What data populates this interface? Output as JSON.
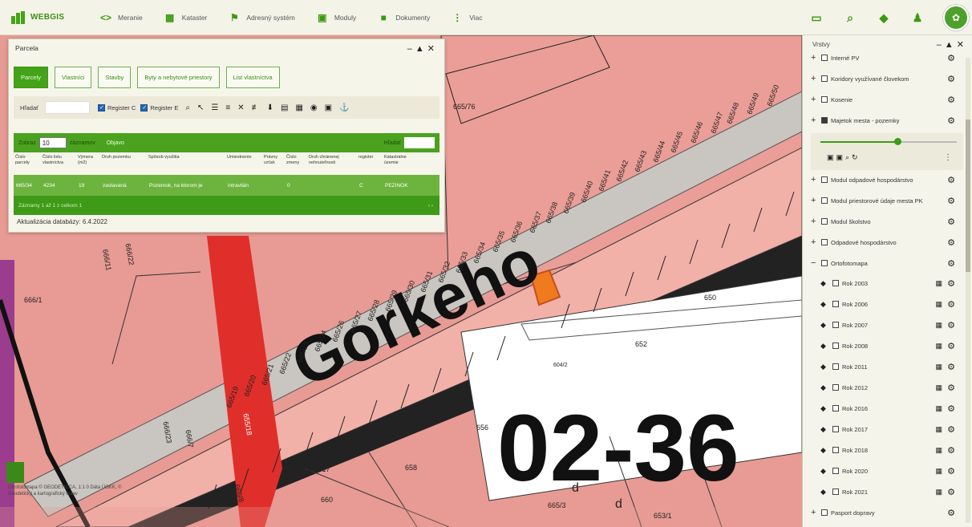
{
  "app": {
    "logo": "WEBGIS"
  },
  "nav": [
    {
      "label": "Meranie",
      "icon": "code-brackets-icon"
    },
    {
      "label": "Kataster",
      "icon": "grid-icon"
    },
    {
      "label": "Adresný systém",
      "icon": "flag-icon"
    },
    {
      "label": "Moduly",
      "icon": "book-icon"
    },
    {
      "label": "Dokumenty",
      "icon": "briefcase-icon"
    },
    {
      "label": "Viac",
      "icon": "more-vertical-icon"
    }
  ],
  "map": {
    "labels": [
      "665/76",
      "665/50",
      "665/49",
      "665/48",
      "665/47",
      "665/46",
      "665/45",
      "665/44",
      "665/43",
      "665/42",
      "665/41",
      "665/40",
      "665/39",
      "665/38",
      "665/37",
      "665/36",
      "665/35",
      "665/34",
      "665/33",
      "665/32",
      "665/31",
      "665/30",
      "665/29",
      "665/28",
      "665/27",
      "665/26",
      "665/24",
      "665/23",
      "665/22",
      "665/21",
      "665/20",
      "665/19",
      "666/22",
      "666/11",
      "666/1",
      "648/2",
      "650",
      "652",
      "604/2",
      "656",
      "658",
      "660",
      "653/1",
      "665/3",
      "665/17",
      "666/7",
      "666/23",
      "655/18",
      "666/8",
      "d",
      "d"
    ],
    "street_text": "Gorkeho",
    "zone_text": "02-36",
    "scale": "Ortofotomapa © GEODETICCA, 1:1 0 Dáta ÚGKK, © Geodetický a kartografický ústav"
  },
  "parcel_panel": {
    "title": "Parcela",
    "tabs": [
      "Parcely",
      "Vlastníci",
      "Stavby",
      "Byty a nebytové priestory",
      "List vlastníctva"
    ],
    "search_label": "Hľadať",
    "register_c": "Register C",
    "register_e": "Register E",
    "show_label": "Zobraz",
    "page_size": "10",
    "page_size_suffix": "záznamov",
    "filter_label": "Objavo",
    "grid_search_label": "Hľadať",
    "columns": [
      "Číslo parcely",
      "Číslo listu vlastníctva",
      "Výmera (m2)",
      "Druh pozemku",
      "Spôsob využitia",
      "Umiestnenie",
      "Právny vzťah",
      "Číslo zmeny",
      "Druh chránenej nehnuteľnosti",
      "register",
      "Katastrálne územie"
    ],
    "row": [
      "665/34",
      "4234",
      "19",
      "zastavaná",
      "Pozemok, na ktorom je",
      "intravilán",
      "",
      "0",
      "",
      "C",
      "PEZINOK"
    ],
    "footer": "Záznamy 1 až 1 z celkom 1",
    "updated": "Aktualizácia databázy: 6.4.2022"
  },
  "layers": {
    "title": "Vrstvy",
    "items": [
      {
        "label": "Interné PV",
        "expand": "+",
        "checked": false
      },
      {
        "label": "Koridory využívané človekom",
        "expand": "+",
        "checked": false
      },
      {
        "label": "Kosenie",
        "expand": "+",
        "checked": false
      },
      {
        "label": "Majetok mesta - pozemky",
        "expand": "+",
        "checked": true
      },
      {
        "label": "Modul odpadové hospodárstvo",
        "expand": "+",
        "checked": false
      },
      {
        "label": "Modul priestorové údaje mesta PK",
        "expand": "+",
        "checked": false
      },
      {
        "label": "Modul školstvo",
        "expand": "+",
        "checked": false
      },
      {
        "label": "Odpadové hospodárstvo",
        "expand": "+",
        "checked": false
      },
      {
        "label": "Ortofotomapa",
        "expand": "−",
        "checked": false
      },
      {
        "label": "Rok 2003",
        "sub": true
      },
      {
        "label": "Rok 2006",
        "sub": true
      },
      {
        "label": "Rok 2007",
        "sub": true
      },
      {
        "label": "Rok 2008",
        "sub": true
      },
      {
        "label": "Rok 2011",
        "sub": true
      },
      {
        "label": "Rok 2012",
        "sub": true
      },
      {
        "label": "Rok 2016",
        "sub": true
      },
      {
        "label": "Rok 2017",
        "sub": true
      },
      {
        "label": "Rok 2018",
        "sub": true
      },
      {
        "label": "Rok 2020",
        "sub": true
      },
      {
        "label": "Rok 2021",
        "sub": true
      },
      {
        "label": "Pasport dopravy",
        "expand": "+",
        "checked": false
      }
    ]
  }
}
